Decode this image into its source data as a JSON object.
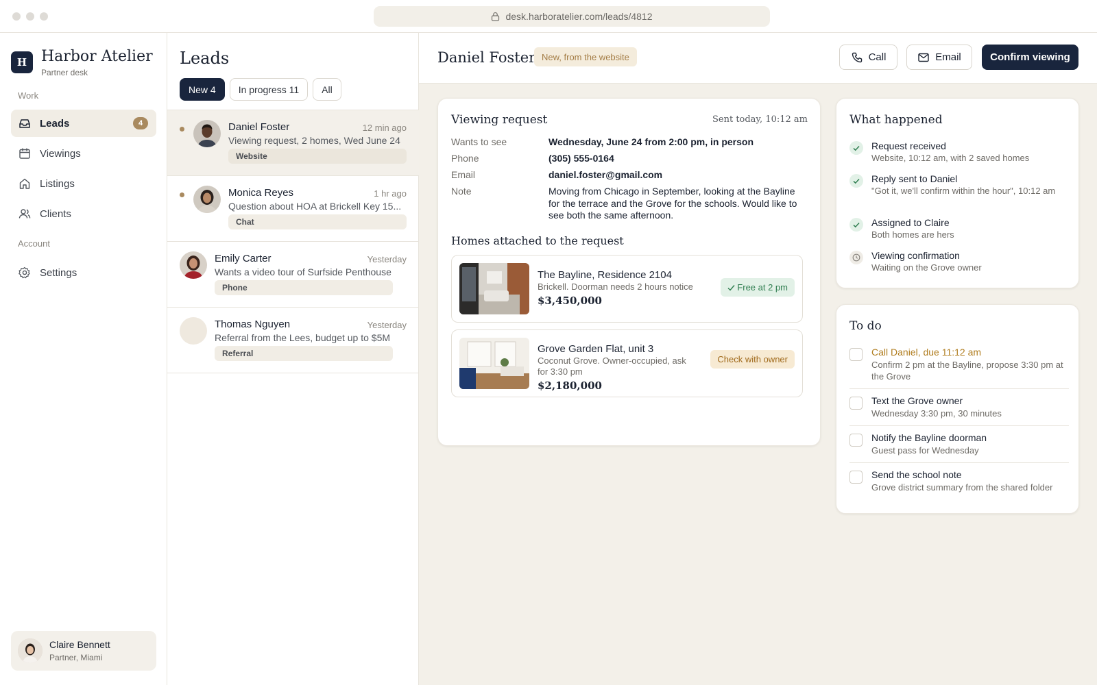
{
  "browser": {
    "url": "desk.harboratelier.com/leads/4812"
  },
  "brand": {
    "logo_letter": "H",
    "name": "Harbor Atelier",
    "subtitle": "Partner desk"
  },
  "sidebar": {
    "sections": [
      "Work",
      "Account"
    ],
    "items": [
      {
        "label": "Leads",
        "icon": "inbox-icon",
        "badge": "4",
        "active": true
      },
      {
        "label": "Viewings",
        "icon": "calendar-icon"
      },
      {
        "label": "Listings",
        "icon": "home-icon"
      },
      {
        "label": "Clients",
        "icon": "users-icon"
      },
      {
        "label": "Settings",
        "icon": "gear-icon"
      }
    ],
    "user": {
      "name": "Claire Bennett",
      "role": "Partner, Miami"
    }
  },
  "leads": {
    "title": "Leads",
    "tabs": [
      {
        "label": "New 4",
        "active": true
      },
      {
        "label": "In progress 11"
      },
      {
        "label": "All"
      }
    ],
    "items": [
      {
        "name": "Daniel Foster",
        "time": "12 min ago",
        "preview": "Viewing request, 2 homes, Wed June 24",
        "source": "Website",
        "unread": true,
        "selected": true
      },
      {
        "name": "Monica Reyes",
        "time": "1 hr ago",
        "preview": "Question about HOA at Brickell Key 15...",
        "source": "Chat",
        "unread": true
      },
      {
        "name": "Emily Carter",
        "time": "Yesterday",
        "preview": "Wants a video tour of Surfside Penthouse",
        "source": "Phone"
      },
      {
        "name": "Thomas Nguyen",
        "time": "Yesterday",
        "preview": "Referral from the Lees, budget up to $5M",
        "source": "Referral"
      }
    ]
  },
  "detail": {
    "name": "Daniel Foster",
    "status": "New, from the website",
    "actions": {
      "call": "Call",
      "email": "Email",
      "confirm": "Confirm viewing"
    },
    "request": {
      "title": "Viewing request",
      "sent": "Sent today, 10:12 am",
      "rows": [
        {
          "label": "Wants to see",
          "value": "Wednesday, June 24 from 2:00 pm, in person"
        },
        {
          "label": "Phone",
          "value": "(305) 555-0164"
        },
        {
          "label": "Email",
          "value": "daniel.foster@gmail.com"
        },
        {
          "label": "Note",
          "value": "Moving from Chicago in September, looking at the Bayline for the terrace and the Grove for the schools. Would like to see both the same afternoon."
        }
      ],
      "homes_title": "Homes attached to the request",
      "homes": [
        {
          "name": "The Bayline, Residence 2104",
          "desc": "Brickell. Doorman needs 2 hours notice",
          "price": "$3,450,000",
          "badge": "Free at 2 pm"
        },
        {
          "name": "Grove Garden Flat, unit 3",
          "desc": "Coconut Grove. Owner-occupied, ask for 3:30 pm",
          "price": "$2,180,000",
          "badge": "Check with owner"
        }
      ]
    },
    "timeline": {
      "title": "What happened",
      "items": [
        {
          "title": "Request received",
          "sub": "Website, 10:12 am, with 2 saved homes",
          "done": true
        },
        {
          "title": "Reply sent to Daniel",
          "sub": "\"Got it, we'll confirm within the hour\", 10:12 am",
          "done": true
        },
        {
          "title": "Assigned to Claire",
          "sub": "Both homes are hers",
          "done": true
        },
        {
          "title": "Viewing confirmation",
          "sub": "Waiting on the Grove owner",
          "done": false
        }
      ]
    },
    "todo": {
      "title": "To do",
      "items": [
        {
          "title": "Call Daniel, due 11:12 am",
          "sub": "Confirm 2 pm at the Bayline, propose 3:30 pm at the Grove",
          "urgent": true
        },
        {
          "title": "Text the Grove owner",
          "sub": "Wednesday 3:30 pm, 30 minutes"
        },
        {
          "title": "Notify the Bayline doorman",
          "sub": "Guest pass for Wednesday"
        },
        {
          "title": "Send the school note",
          "sub": "Grove district summary from the shared folder"
        }
      ]
    }
  },
  "colors": {
    "navy": "#19253d",
    "accent_gold": "#a98a5f",
    "urgent_text": "#b07d1f",
    "success_green": "#2e7d4f",
    "canvas": "#f3f0e9"
  }
}
